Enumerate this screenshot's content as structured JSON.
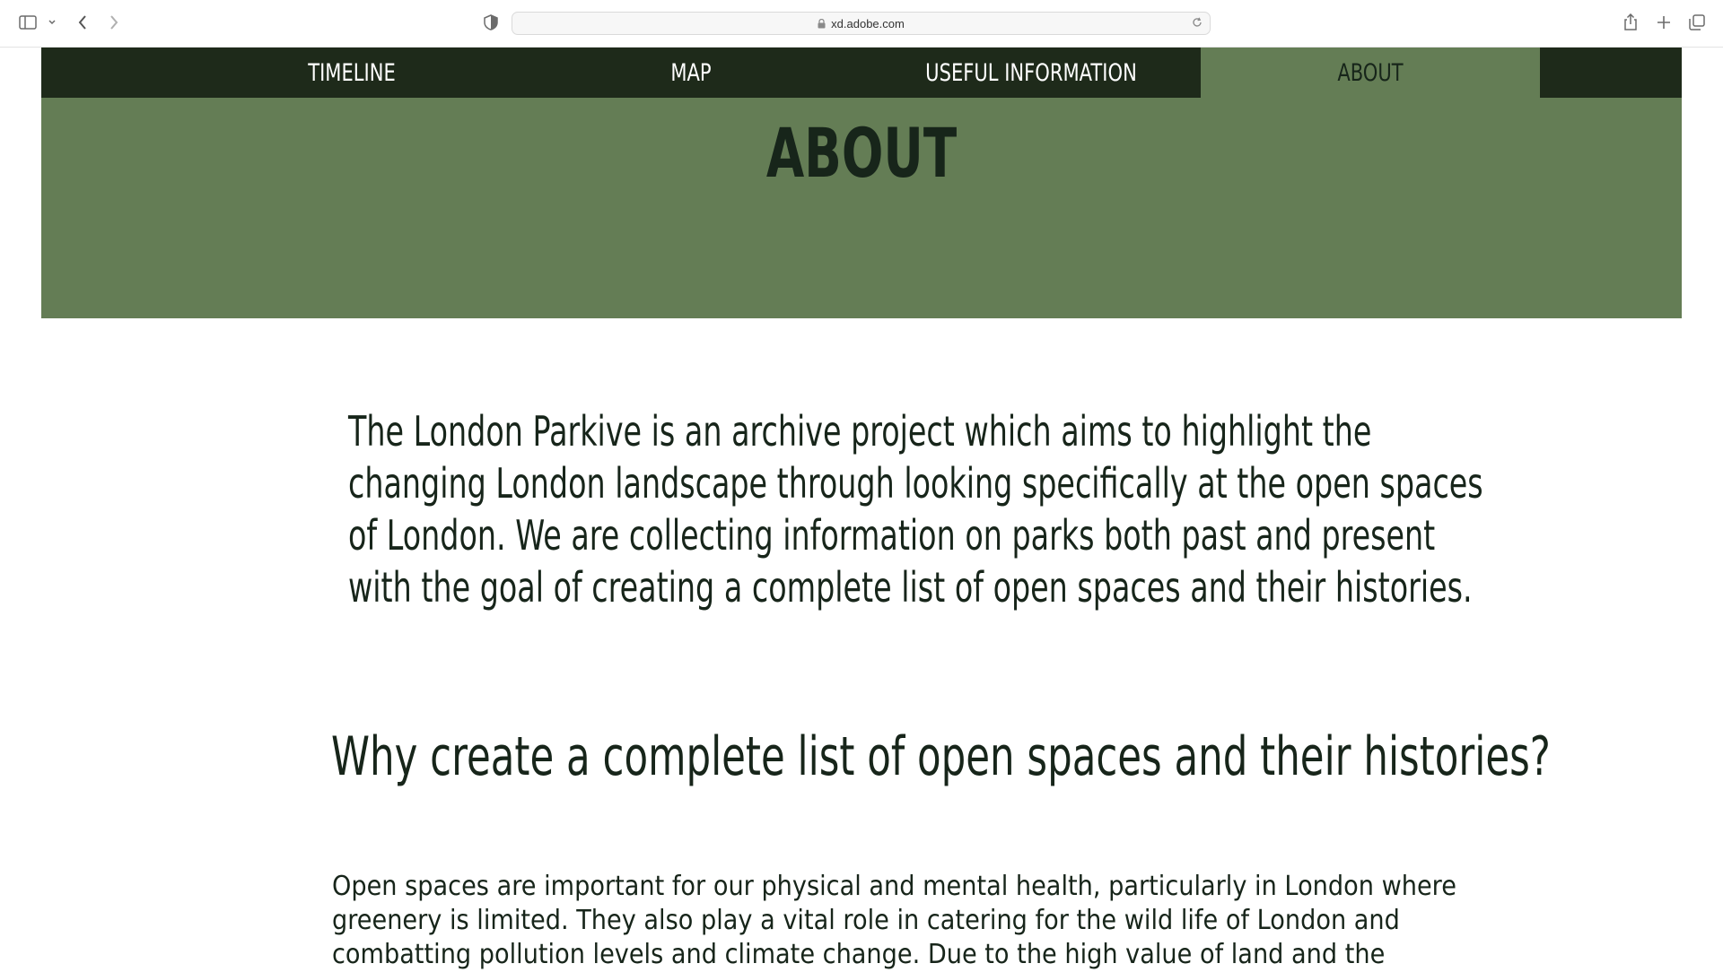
{
  "browser": {
    "url": "xd.adobe.com",
    "icons": [
      "sidebar-icon",
      "chevron-down-icon",
      "back-icon",
      "forward-icon",
      "privacy-shield-icon",
      "lock-icon",
      "reload-icon",
      "share-icon",
      "new-tab-icon",
      "tabs-overview-icon"
    ]
  },
  "nav": {
    "items": [
      {
        "label": "TIMELINE"
      },
      {
        "label": "MAP"
      },
      {
        "label": "USEFUL INFORMATION"
      },
      {
        "label": "ABOUT"
      }
    ],
    "active": "ABOUT"
  },
  "hero": {
    "title": "ABOUT"
  },
  "intro": {
    "lines": [
      "The London Parkive is an archive project which aims to highlight the",
      "changing London landscape through looking specifically at the open spaces",
      "of London. We are collecting information on parks both past and present",
      "with the goal of creating a complete list of open spaces and their histories."
    ]
  },
  "section": {
    "heading": "Why create a complete list of open spaces and their histories?",
    "body_lines": [
      "Open spaces are important for our physical and mental health, particularly in London where",
      "greenery is limited. They also play a vital role in catering for the wild life of London and",
      "combatting pollution levels and climate change. Due to the high value of land and the"
    ]
  },
  "colors": {
    "nav_bg": "#1e2a1a",
    "accent_green": "#647d55",
    "text_dark": "#17251a"
  }
}
